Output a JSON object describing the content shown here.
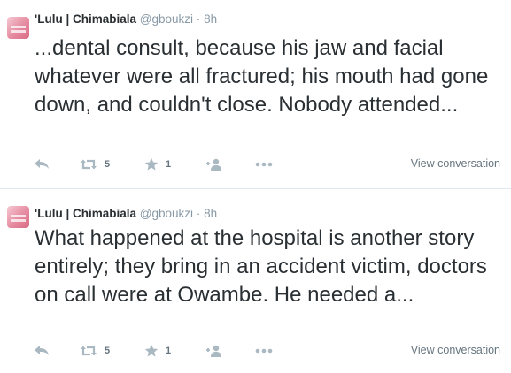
{
  "tweets": [
    {
      "fullname": "'Lulu | Chimabiala",
      "username": "@gboukzi",
      "separator": "·",
      "time": "8h",
      "text": "...dental consult, because his jaw and facial whatever were all fractured; his mouth had gone down, and couldn't close. Nobody attended...",
      "retweet_count": "5",
      "favorite_count": "1",
      "view_conversation": "View conversation"
    },
    {
      "fullname": "'Lulu | Chimabiala",
      "username": "@gboukzi",
      "separator": "·",
      "time": "8h",
      "text": "What happened at the hospital is another story entirely; they bring in an accident victim, doctors on call were at Owambe. He needed a...",
      "retweet_count": "5",
      "favorite_count": "1",
      "view_conversation": "View conversation"
    }
  ],
  "icons": {
    "reply": "reply-icon",
    "retweet": "retweet-icon",
    "favorite": "star-icon",
    "follow": "add-user-icon",
    "more": "more-icon"
  },
  "colors": {
    "text": "#292f33",
    "muted": "#8899a6",
    "icon": "#aab8c2",
    "divider": "#e1e8ed"
  }
}
